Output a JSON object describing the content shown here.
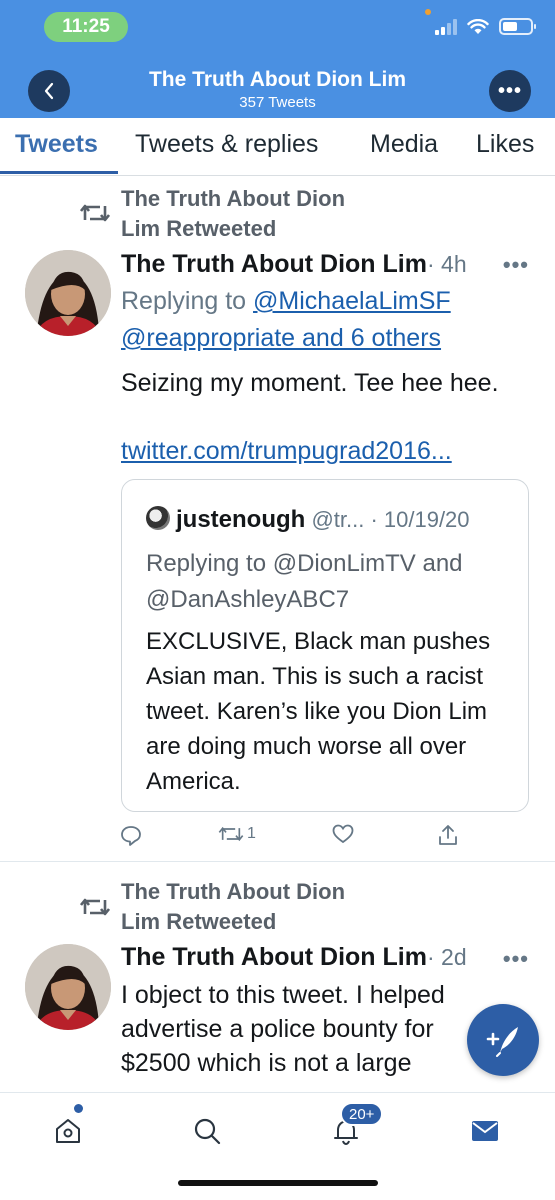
{
  "status_bar": {
    "time": "11:25"
  },
  "header": {
    "title": "The Truth About Dion Lim",
    "subtitle": "357 Tweets",
    "back_icon": "chevron-left-icon",
    "more_label": "•••"
  },
  "tabs": [
    {
      "label": "Tweets",
      "active": true
    },
    {
      "label": "Tweets & replies",
      "active": false
    },
    {
      "label": "Media",
      "active": false
    },
    {
      "label": "Likes",
      "active": false
    }
  ],
  "tweets": [
    {
      "retweet_line1": "The Truth About Dion",
      "retweet_line2": "Lim Retweeted",
      "name": "The Truth About Dion Lim",
      "meta": "· 4h",
      "more_label": "•••",
      "reply_prefix": "Replying to ",
      "reply_link1": "@MichaelaLimSF",
      "reply_link2": "@reappropriate and 6 others",
      "text": "Seizing my moment. Tee hee hee.",
      "url": "twitter.com/trumpugrad2016...",
      "quote": {
        "name": "justenough",
        "meta": " @tr... · 10/19/20",
        "reply": "Replying to @DionLimTV and @DanAshleyABC7",
        "text": "EXCLUSIVE, Black man pushes Asian man. This is such a racist tweet. Karen’s like you Dion Lim are doing much worse all over America."
      },
      "retweet_count": "1"
    },
    {
      "retweet_line1": "The Truth About Dion",
      "retweet_line2": "Lim Retweeted",
      "name": "The Truth About Dion Lim",
      "meta": "· 2d",
      "more_label": "•••",
      "text": "I object to this tweet. I helped advertise a police bounty for $2500 which is not a large"
    }
  ],
  "bottom_nav": {
    "notifications_badge": "20+"
  },
  "colors": {
    "header": "#4a90e2",
    "accent": "#2d5ea6",
    "link": "#1b5fad"
  }
}
